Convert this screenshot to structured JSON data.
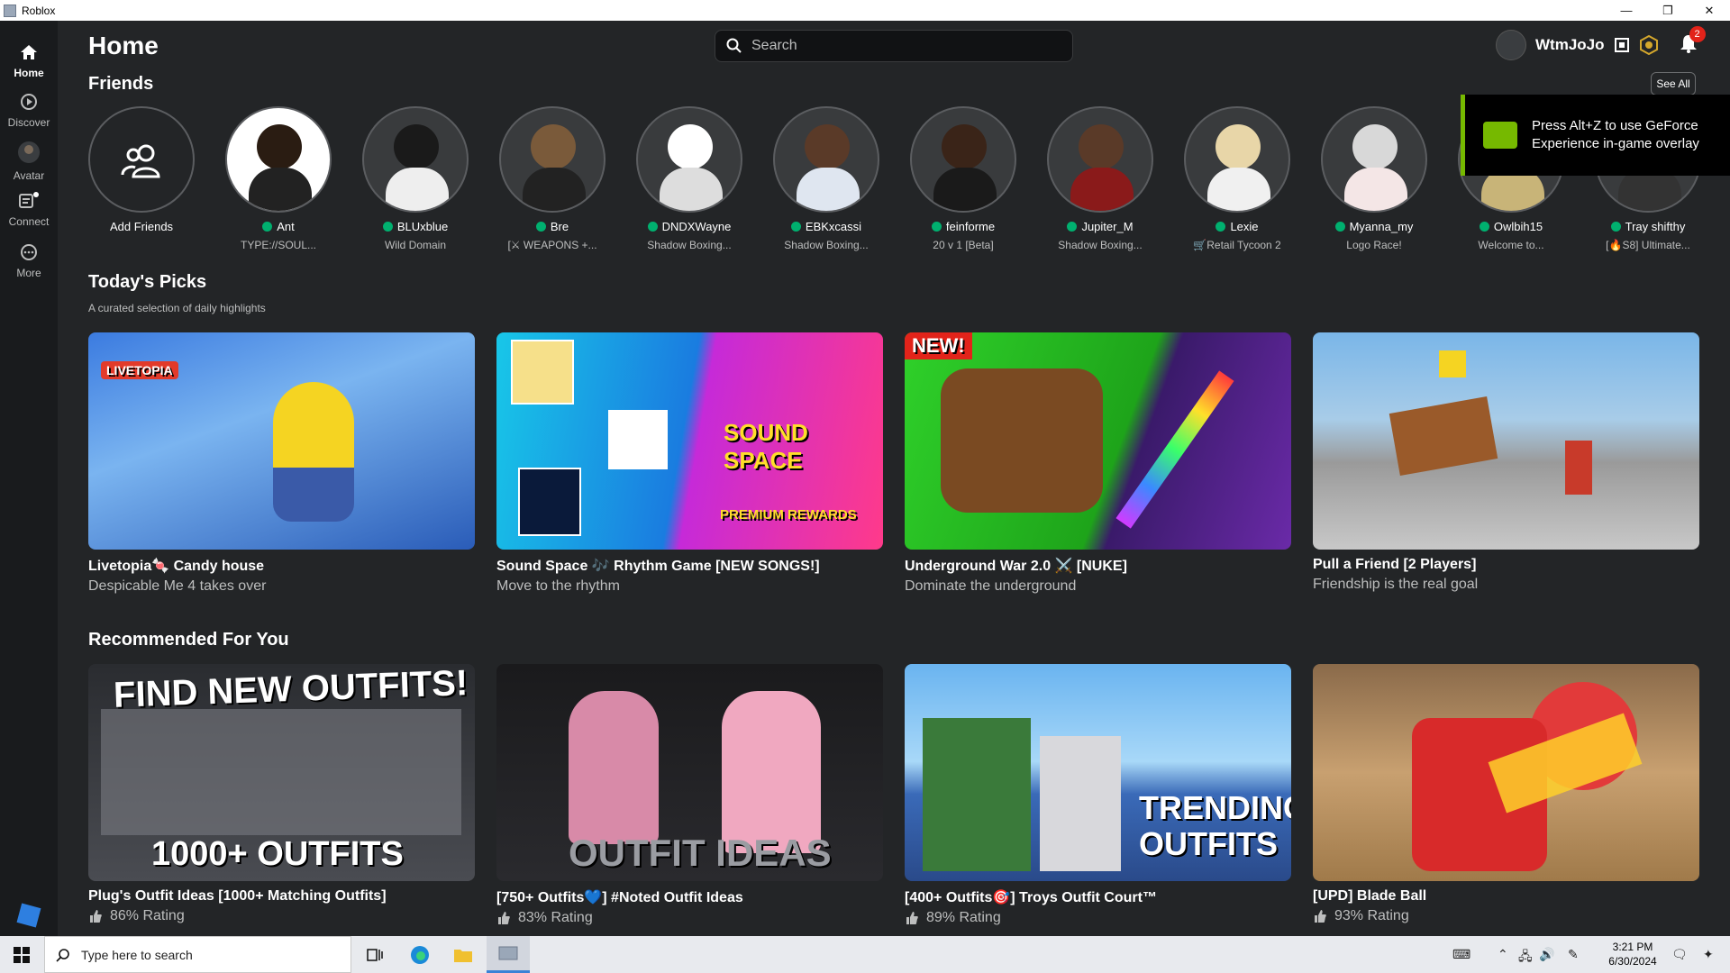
{
  "window": {
    "title": "Roblox"
  },
  "sidebar": {
    "items": [
      {
        "label": "Home",
        "icon": "home-icon",
        "active": true
      },
      {
        "label": "Discover",
        "icon": "discover-icon"
      },
      {
        "label": "Avatar",
        "icon": "avatar-icon"
      },
      {
        "label": "Connect",
        "icon": "chat-icon"
      },
      {
        "label": "More",
        "icon": "more-icon"
      }
    ]
  },
  "header": {
    "title": "Home",
    "search_placeholder": "Search",
    "username": "WtmJoJo",
    "notification_count": "2"
  },
  "friends": {
    "title": "Friends",
    "see_all": "See All",
    "add_label": "Add Friends",
    "items": [
      {
        "name": "Ant",
        "game": "TYPE://SOUL..."
      },
      {
        "name": "BLUxblue",
        "game": "Wild Domain"
      },
      {
        "name": "Bre",
        "game": "[⚔ WEAPONS +..."
      },
      {
        "name": "DNDXWayne",
        "game": "Shadow Boxing..."
      },
      {
        "name": "EBKxcassi",
        "game": "Shadow Boxing..."
      },
      {
        "name": "feinforme",
        "game": "20 v 1 [Beta]"
      },
      {
        "name": "Jupiter_M",
        "game": "Shadow Boxing..."
      },
      {
        "name": "Lexie",
        "game": "🛒Retail Tycoon 2"
      },
      {
        "name": "Myanna_my",
        "game": "Logo Race!"
      },
      {
        "name": "Owlbih15",
        "game": "Welcome to..."
      },
      {
        "name": "Tray shifthy",
        "game": "[🔥S8] Ultimate..."
      }
    ]
  },
  "overlay": {
    "text": "Press Alt+Z to use GeForce Experience in-game overlay"
  },
  "todays_picks": {
    "title": "Today's Picks",
    "subtitle": "A curated selection of daily highlights",
    "items": [
      {
        "title": "Livetopia🍬 Candy house",
        "desc": "Despicable Me 4 takes over"
      },
      {
        "title": "Sound Space 🎶 Rhythm Game [NEW SONGS!]",
        "desc": "Move to the rhythm"
      },
      {
        "title": "Underground War 2.0 ⚔️ [NUKE]",
        "desc": "Dominate the underground"
      },
      {
        "title": "Pull a Friend [2 Players]",
        "desc": "Friendship is the real goal"
      }
    ]
  },
  "recommended": {
    "title": "Recommended For You",
    "items": [
      {
        "title": "Plug's Outfit Ideas [1000+ Matching Outfits]",
        "rating": "86% Rating"
      },
      {
        "title": "[750+ Outfits💙] #Noted Outfit Ideas",
        "rating": "83% Rating"
      },
      {
        "title": "[400+ Outfits🎯] Troys Outfit Court™",
        "rating": "89% Rating"
      },
      {
        "title": "[UPD] Blade Ball",
        "rating": "93% Rating"
      }
    ]
  },
  "thumb_text": {
    "livetopia": "LIVETOPIA",
    "new_badge": "NEW!",
    "sound": "SOUND SPACE",
    "premium": "PREMIUM REWARDS",
    "find_outfits": "FIND NEW OUTFITS!",
    "outfits_1000": "1000+ OUTFITS",
    "outfit_ideas": "OUTFIT IDEAS",
    "trending": "TRENDING OUTFITS"
  },
  "taskbar": {
    "search_placeholder": "Type here to search",
    "time": "3:21 PM",
    "date": "6/30/2024"
  }
}
